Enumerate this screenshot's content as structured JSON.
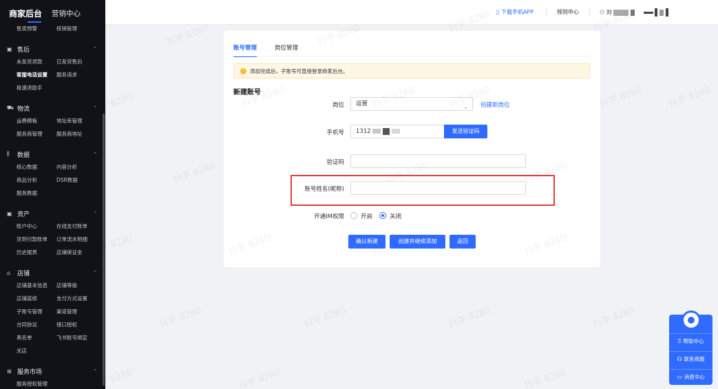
{
  "sidebar": {
    "brand": "商家后台",
    "tab": "营销中心",
    "top_row": [
      "售卖预警",
      "核销管理"
    ],
    "groups": [
      {
        "icon": "▣",
        "title": "售后",
        "rows": [
          [
            "未发货退款",
            "已发货售后"
          ],
          [
            "客服电话设置",
            "服务请求"
          ],
          [
            "极速退助手"
          ]
        ],
        "active": "客服电话设置"
      },
      {
        "icon": "⛟",
        "title": "物流",
        "rows": [
          [
            "运费模板",
            "地址库管理"
          ],
          [
            "服务商管理",
            "服务商地址"
          ]
        ]
      },
      {
        "icon": "⫼",
        "title": "数据",
        "rows": [
          [
            "核心数据",
            "内容分析"
          ],
          [
            "商品分析",
            "DSR数据"
          ],
          [
            "服务数据"
          ]
        ]
      },
      {
        "icon": "▣",
        "title": "资产",
        "rows": [
          [
            "账户中心",
            "在线支付账单"
          ],
          [
            "货到付款账单",
            "订单流水明细"
          ],
          [
            "历史报表",
            "店铺保证金"
          ]
        ]
      },
      {
        "icon": "⌂",
        "title": "店铺",
        "rows": [
          [
            "店铺基本信息",
            "店铺等级"
          ],
          [
            "店铺装修",
            "支付方式设置"
          ],
          [
            "子账号管理",
            "渠道管理"
          ],
          [
            "合同协议",
            "接口授权"
          ],
          [
            "黑名单",
            "飞书账号绑定"
          ],
          [
            "关店"
          ]
        ]
      },
      {
        "icon": "⊞",
        "title": "服务市场",
        "rows": [
          [
            "服务授权管理"
          ]
        ]
      }
    ]
  },
  "topbar": {
    "app_link": "下载手机APP",
    "rules": "规则中心",
    "user": "刘"
  },
  "tabs": [
    "账号管理",
    "岗位管理"
  ],
  "notice": "添加完成后，子账号可直接登录商家后台。",
  "section_title": "新建账号",
  "form": {
    "position_label": "岗位",
    "position_value": "运营",
    "create_position_link": "创建新岗位",
    "phone_label": "手机号",
    "phone_value": "1312",
    "send_code_button": "发送验证码",
    "code_label": "验证码",
    "code_value": "",
    "name_label": "账号姓名(昵称)",
    "name_value": "",
    "im_label": "开通IM权限",
    "im_options": [
      "开启",
      "关闭"
    ],
    "im_selected": "关闭"
  },
  "buttons": {
    "confirm": "确认新建",
    "create_continue": "创建并继续添加",
    "back": "返回"
  },
  "watermark": "抖字 8280",
  "help_widget": {
    "items": [
      "帮助中心",
      "联系商服",
      "消息中心"
    ]
  },
  "colors": {
    "primary": "#2f6bff",
    "sidebar_bg": "#101218",
    "highlight_border": "#e33b3b",
    "notice_bg": "#fff7e6"
  }
}
